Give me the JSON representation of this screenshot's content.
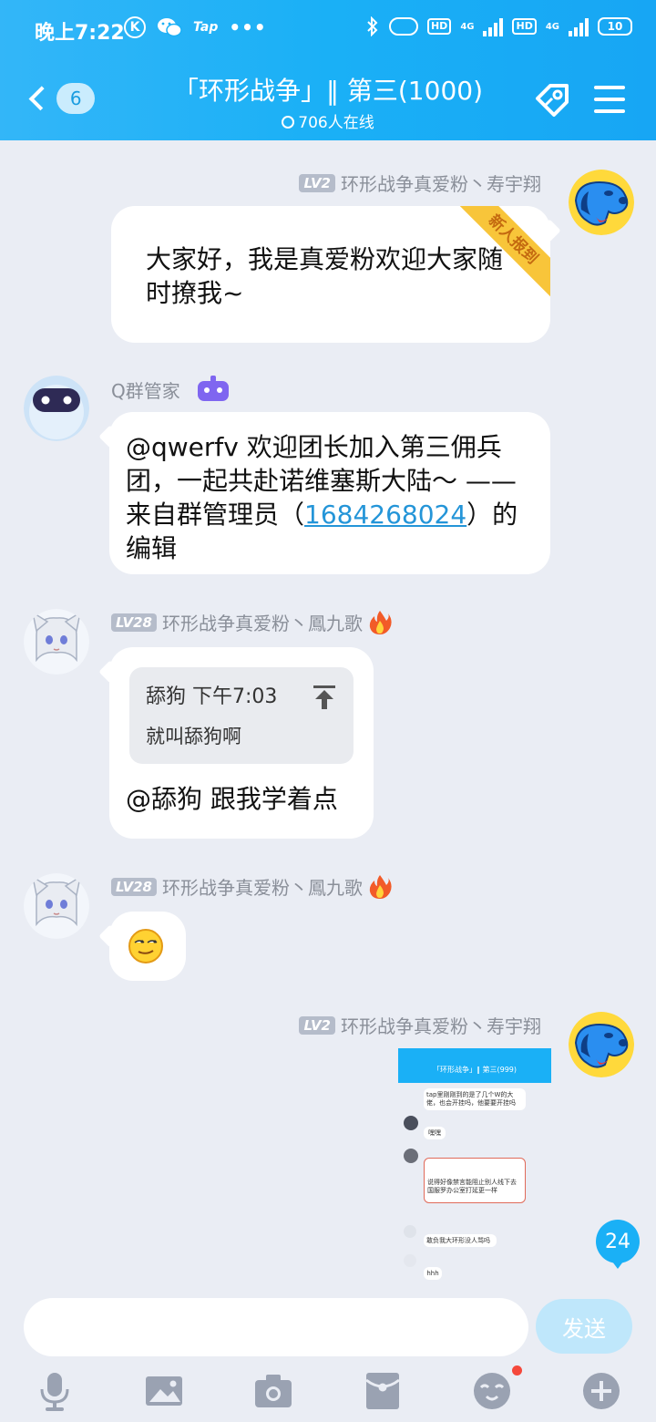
{
  "status": {
    "time": "晚上7:22",
    "k": "K",
    "tap": "Tap",
    "dots": "•••",
    "hd1": "HD",
    "hd2": "HD",
    "net1": "4G",
    "net2": "4G",
    "battery": "10"
  },
  "header": {
    "unread_count": "6",
    "title": "「环形战争」‖ 第三(1000)",
    "online": "706人在线"
  },
  "messages": [
    {
      "level": "LV2",
      "sender": "环形战争真爱粉丶寿宇翔",
      "ribbon": "新人报到",
      "text": "大家好，我是真爱粉欢迎大家随时撩我~"
    },
    {
      "sender": "Q群管家",
      "text_before": "@qwerfv 欢迎团长加入第三佣兵团，一起共赴诺维塞斯大陆～ ——来自群管理员（",
      "link": "1684268024",
      "text_after": "）的编辑"
    },
    {
      "level": "LV28",
      "sender": "环形战争真爱粉丶鳳九歌",
      "quote_head": "舔狗 下午7:03",
      "quote_body": "就叫舔狗啊",
      "text": "@舔狗 跟我学着点"
    },
    {
      "level": "LV28",
      "sender": "环形战争真爱粉丶鳳九歌",
      "emoji": "smirk-face"
    },
    {
      "level": "LV2",
      "sender": "环形战争真爱粉丶寿宇翔",
      "image": "chat-screenshot",
      "thumb": {
        "title": "「环形战争」‖ 第三(999)",
        "line1": "tap里刚刚到的是了几个W的大佬，也会开挂吗，他要要开挂吗",
        "reply1": "嘿嘿",
        "line2": "说得好像禁言能阻止别人线下去国服罗办公室打延更一样",
        "line3": "敢负我大环形没人骂吗",
        "reply2": "hhh"
      }
    }
  ],
  "new_messages_badge": "24",
  "composer": {
    "placeholder": "",
    "send_label": "发送"
  },
  "toolbar": [
    "mic-icon",
    "image-icon",
    "camera-icon",
    "red-packet-icon",
    "emoji-icon",
    "plus-icon"
  ],
  "colors": {
    "header": "#1ab0f6",
    "background": "#eaedf4",
    "link": "#2495d8",
    "ribbon": "#f8c53a",
    "unread_dot": "#f5483b"
  }
}
